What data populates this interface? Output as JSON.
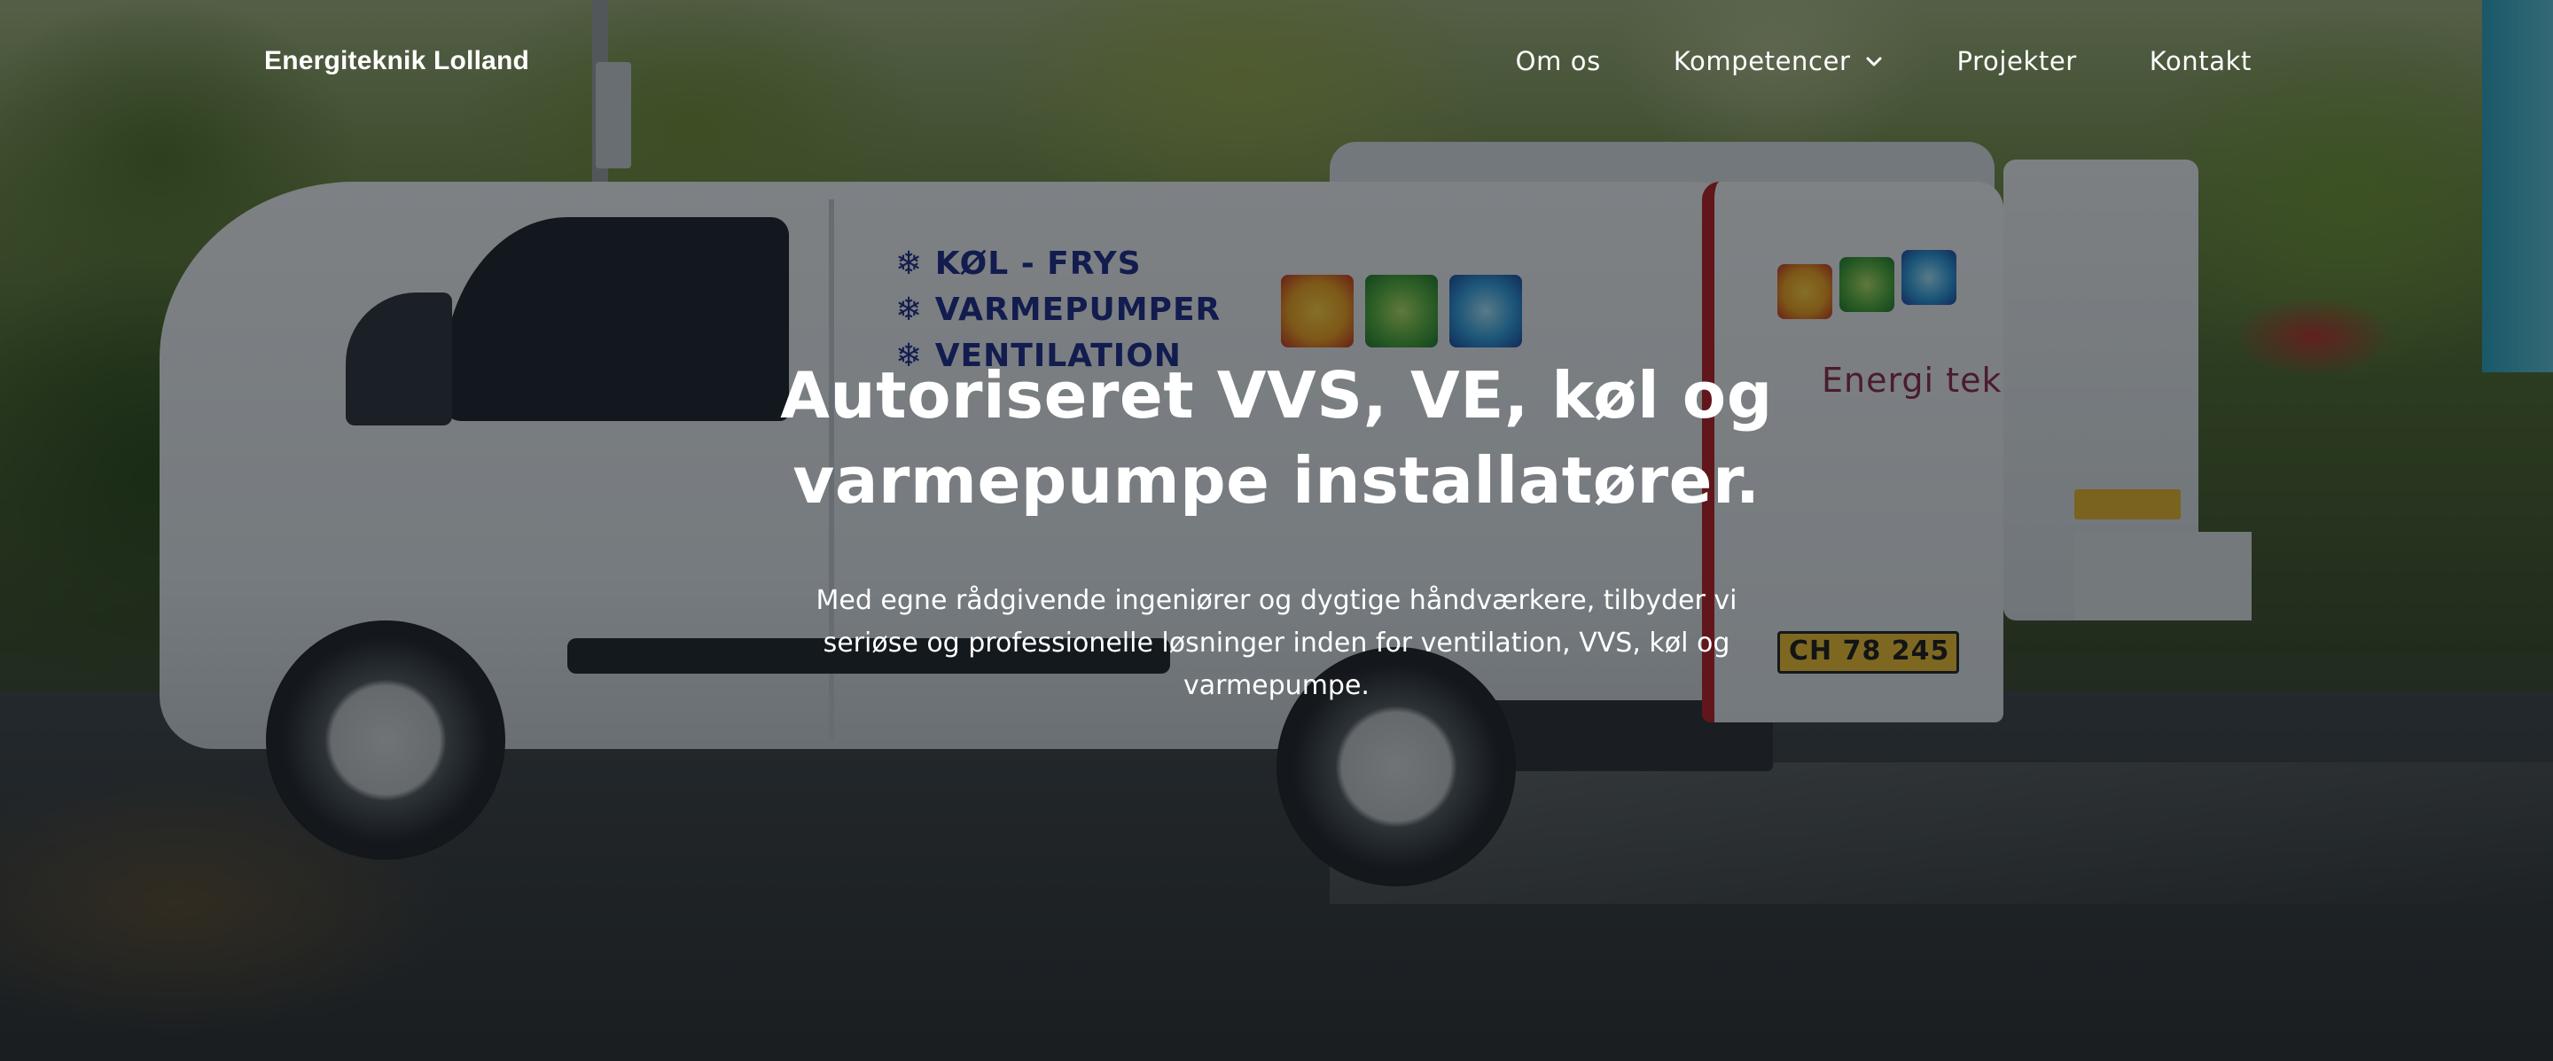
{
  "header": {
    "logo_text": "Energiteknik Lolland",
    "nav": [
      {
        "label": "Om os",
        "has_dropdown": false
      },
      {
        "label": "Kompetencer",
        "has_dropdown": true,
        "icon": "chevron-down-icon"
      },
      {
        "label": "Projekter",
        "has_dropdown": false
      },
      {
        "label": "Kontakt",
        "has_dropdown": false
      }
    ]
  },
  "hero": {
    "title_line1": "Autoriseret VVS, VE, køl og",
    "title_line2": "varmepumpe installatører.",
    "subtitle": "Med egne rådgivende ingeniører og dygtige håndværkere, tilbyder vi seriøse og professionelle løsninger inden for ventilation, VVS, køl og varmepumpe.",
    "background_photo": {
      "van_text": [
        "❄ KØL - FRYS",
        "❄ VARMEPUMPER",
        "❄ VENTILATION"
      ],
      "van_brand": "Energi tek",
      "license_plate": "CH 78 245"
    }
  },
  "colors": {
    "text": "#ffffff",
    "overlay": "rgba(10,14,18,0.5)"
  }
}
